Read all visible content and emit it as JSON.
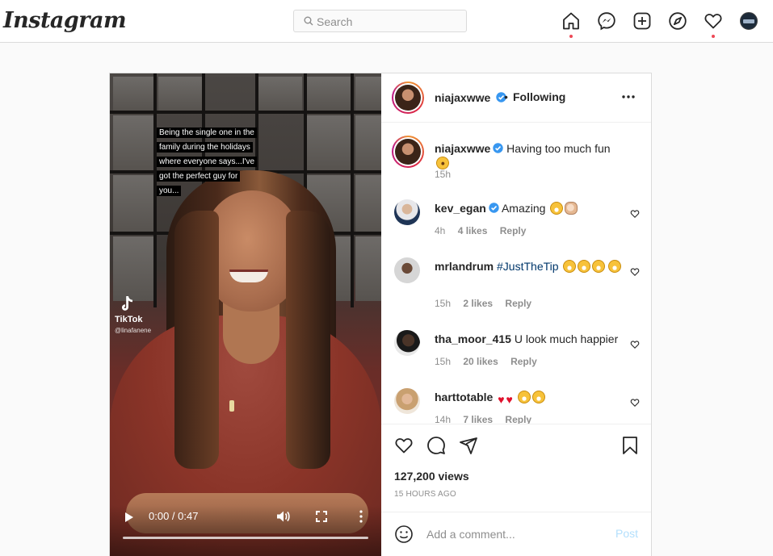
{
  "header": {
    "logo": "Instagram",
    "search_placeholder": "Search",
    "icons": [
      "home-icon",
      "messenger-icon",
      "new-post-icon",
      "explore-icon",
      "activity-heart-icon",
      "profile-avatar"
    ]
  },
  "video": {
    "caption_lines": [
      "Being the single one in the",
      "family during the holidays",
      "where everyone says...I've",
      "got the perfect guy for",
      "you..."
    ],
    "watermark": "TikTok",
    "watermark_user": "@linafanene",
    "time": "0:00 / 0:47"
  },
  "post_header": {
    "username": "niajaxwwe",
    "separator": "•",
    "follow_status": "Following"
  },
  "caption": {
    "username": "niajaxwwe",
    "text": "Having too much fun",
    "time": "15h"
  },
  "comments": [
    {
      "username": "kev_egan",
      "verified": true,
      "text": "Amazing",
      "time": "4h",
      "likes": "4 likes",
      "reply": "Reply"
    },
    {
      "username": "mrlandrum",
      "verified": false,
      "hashtag": "#JustTheTip",
      "text": "",
      "time": "15h",
      "likes": "2 likes",
      "reply": "Reply"
    },
    {
      "username": "tha_moor_415",
      "verified": false,
      "text": "U look much happier",
      "time": "15h",
      "likes": "20 likes",
      "reply": "Reply"
    },
    {
      "username": "harttotable",
      "verified": false,
      "text": "",
      "time": "14h",
      "likes": "7 likes",
      "reply": "Reply"
    }
  ],
  "stats": {
    "views": "127,200 views",
    "ago": "15 HOURS AGO"
  },
  "add_comment": {
    "placeholder": "Add a comment...",
    "post_label": "Post"
  },
  "colors": {
    "verified_blue": "#3897f0",
    "notification_red": "#ed4956",
    "post_button_disabled": "#b2dffc",
    "hashtag": "#00376b"
  }
}
